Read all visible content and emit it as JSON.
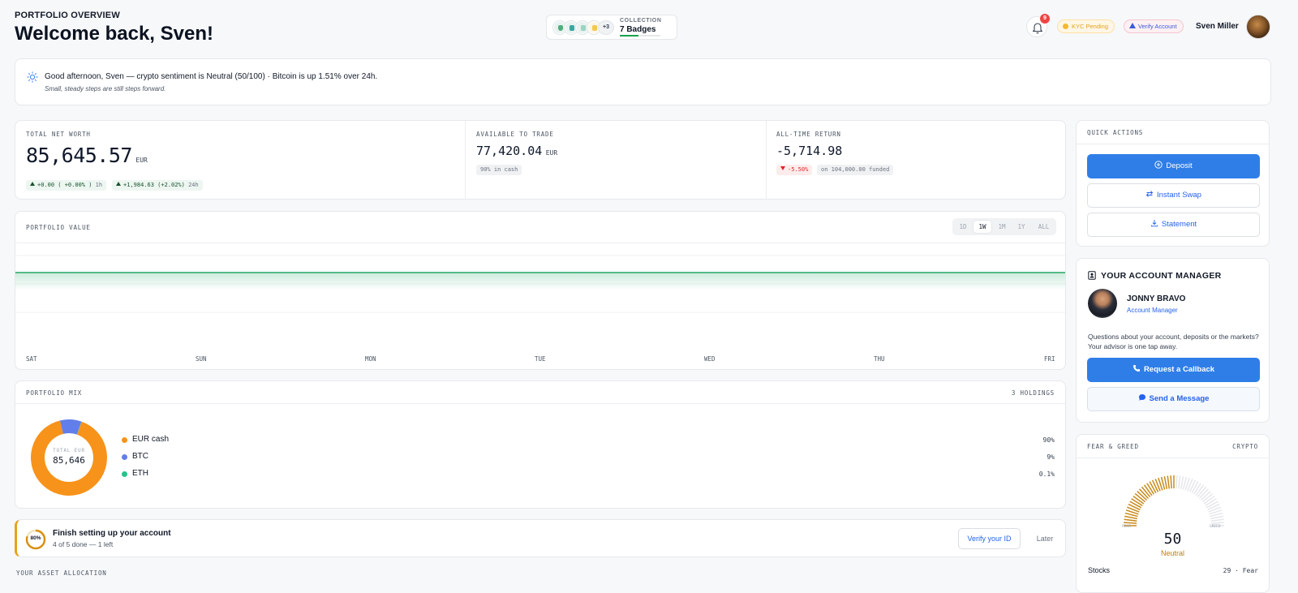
{
  "header": {
    "kicker": "PORTFOLIO OVERVIEW",
    "title": "Welcome back, Sven!",
    "collection": {
      "label": "COLLECTION",
      "value": "7 Badges",
      "more": "+3",
      "progress": 0.45
    },
    "notifications_count": "9",
    "kyc_pill": "KYC Pending",
    "verify_pill": "Verify Account",
    "user_name": "Sven Miller"
  },
  "banner": {
    "line": "Good afternoon, Sven — crypto sentiment is Neutral (50/100) · Bitcoin is up 1.51% over 24h.",
    "sub": "Small, steady steps are still steps forward."
  },
  "stats": {
    "net_worth": {
      "label": "TOTAL NET WORTH",
      "value": "85,645.57",
      "unit": "EUR",
      "chip_1h": "+0.00 ( +0.00% )",
      "chip_1h_period": "1h",
      "chip_24h": "+1,984.63 (+2.02%)",
      "chip_24h_period": "24h"
    },
    "available": {
      "label": "AVAILABLE TO TRADE",
      "value": "77,420.04",
      "unit": "EUR",
      "chip": "90% in cash"
    },
    "return": {
      "label": "ALL-TIME RETURN",
      "value": "-5,714.98",
      "chip_pct": "-5.50%",
      "chip_funded": "on 104,000.00 funded"
    }
  },
  "portfolio_value": {
    "label": "PORTFOLIO VALUE",
    "ranges": [
      "1D",
      "1W",
      "1M",
      "1Y",
      "ALL"
    ],
    "active_range": "1W"
  },
  "chart_data": {
    "type": "area",
    "title": "PORTFOLIO VALUE",
    "categories": [
      "SAT",
      "SUN",
      "MON",
      "TUE",
      "WED",
      "THU",
      "FRI"
    ],
    "series": [
      {
        "values": [
          85645.57,
          85645.57,
          85645.57,
          85645.57,
          85645.57,
          85645.57,
          85645.57
        ]
      }
    ],
    "color": "#22a565",
    "grid": true
  },
  "portfolio_mix": {
    "label": "PORTFOLIO MIX",
    "holdings": "3 HOLDINGS",
    "center_label": "TOTAL EUR",
    "center_value": "85,646",
    "items": [
      {
        "name": "EUR cash",
        "pct": "90%",
        "value": 90,
        "color": "#f7931a"
      },
      {
        "name": "BTC",
        "pct": "9%",
        "value": 9,
        "color": "#627eea"
      },
      {
        "name": "ETH",
        "pct": "0.1%",
        "value": 0.1,
        "color": "#22c58b"
      }
    ]
  },
  "setup": {
    "percent_label": "80%",
    "percent": 80,
    "title": "Finish setting up your account",
    "sub": "4 of 5 done — 1 left",
    "verify_button": "Verify your ID",
    "later_button": "Later"
  },
  "allocation_label": "YOUR ASSET ALLOCATION",
  "quick_actions": {
    "label": "QUICK ACTIONS",
    "deposit": "Deposit",
    "swap": "Instant Swap",
    "statement": "Statement"
  },
  "account_manager": {
    "title": "YOUR ACCOUNT MANAGER",
    "name": "JONNY BRAVO",
    "role": "Account Manager",
    "text": "Questions about your account, deposits or the markets? Your advisor is one tap away.",
    "callback_button": "Request a Callback",
    "message_button": "Send a Message"
  },
  "fear_greed": {
    "label": "FEAR & GREED",
    "tag": "CRYPTO",
    "value": "50",
    "value_num": 50,
    "classification": "Neutral",
    "scale_low": "FEAR",
    "scale_high": "GREED",
    "stocks_label": "Stocks",
    "stocks_value": "29 · Fear"
  },
  "colors": {
    "accent": "#2f7ee8",
    "positive": "#16a34a",
    "negative": "#dc2626",
    "warning": "#e6a21a"
  }
}
